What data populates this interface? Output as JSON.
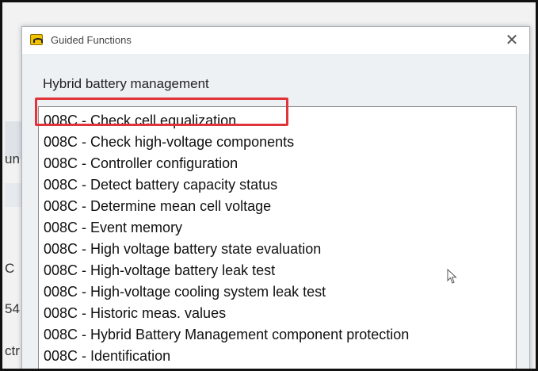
{
  "background": {
    "fragments": [
      "un",
      "C",
      "54",
      "ctr"
    ]
  },
  "dialog": {
    "title": "Guided Functions",
    "close_glyph": "✕",
    "heading": "Hybrid battery management",
    "selected_index": 0,
    "items": [
      "008C - Check cell equalization",
      "008C - Check high-voltage components",
      "008C - Controller configuration",
      "008C - Detect battery capacity status",
      "008C - Determine mean cell voltage",
      "008C - Event memory",
      "008C - High voltage battery state evaluation",
      "008C - High-voltage battery leak test",
      "008C - High-voltage cooling system leak test",
      "008C - Historic meas. values",
      "008C - Hybrid Battery Management component protection",
      "008C - Identification"
    ]
  },
  "colors": {
    "highlight_border": "#e0343a",
    "app_icon": "#f2c200"
  },
  "icons": {
    "app": "app-logo-icon",
    "close": "close-icon",
    "pointer": "mouse-cursor-icon"
  }
}
